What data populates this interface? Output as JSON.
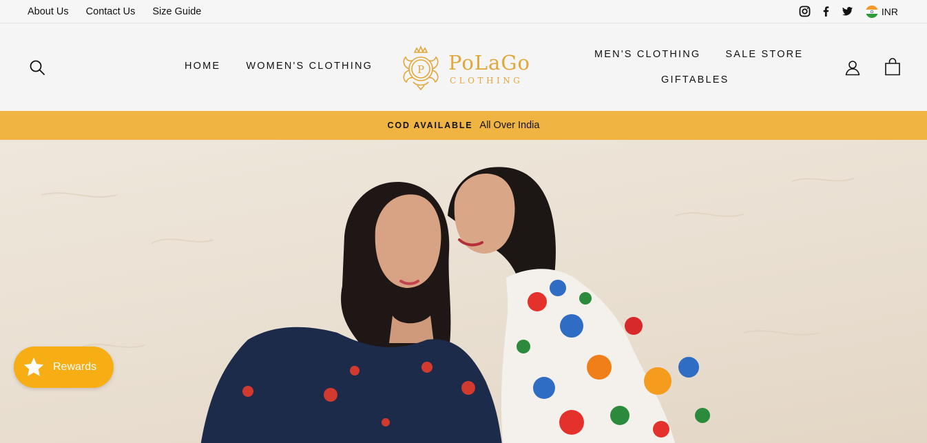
{
  "topbar": {
    "links": [
      "About Us",
      "Contact Us",
      "Size Guide"
    ],
    "social": [
      "instagram-icon",
      "facebook-icon",
      "twitter-icon"
    ],
    "currency": "INR"
  },
  "header": {
    "nav_left": [
      "HOME",
      "WOMEN'S CLOTHING"
    ],
    "nav_right": [
      "MEN'S CLOTHING",
      "SALE STORE",
      "GIFTABLES"
    ],
    "logo": {
      "name": "PoLaGo",
      "sub": "CLOTHING",
      "monogram": "P"
    },
    "icons": [
      "search-icon",
      "user-icon",
      "bag-icon"
    ]
  },
  "announcement": {
    "strong": "COD AVAILABLE",
    "text": "All Over India"
  },
  "rewards": {
    "label": "Rewards"
  },
  "colors": {
    "accent": "#f0b443",
    "logo_gold": "#e2a63a",
    "rewards": "#f7ad14",
    "navy": "#1d2b4a"
  }
}
